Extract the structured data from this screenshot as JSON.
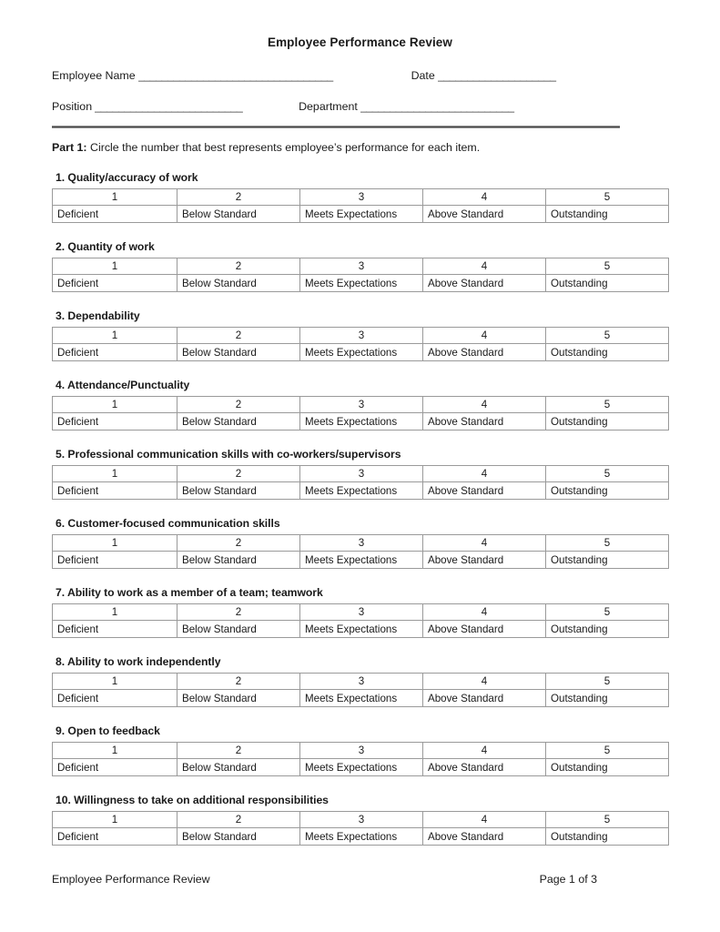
{
  "document": {
    "title": "Employee Performance Review"
  },
  "identification": {
    "employee_name_label": "Employee Name",
    "employee_name_value": "",
    "employee_name_rule": "_________________________________",
    "date_label": "Date",
    "date_value": "",
    "date_rule": "____________________",
    "position_label": "Position",
    "position_value": "",
    "position_rule": "_________________________",
    "department_label": "Department",
    "department_value": "",
    "department_rule": "__________________________"
  },
  "instructions": {
    "part_label": "Part 1:",
    "part_text": " Circle the number that best represents employee’s performance for each item."
  },
  "scale": {
    "scores": [
      "1",
      "2",
      "3",
      "4",
      "5"
    ],
    "labels": [
      "Deficient",
      "Below Standard",
      "Meets Expectations",
      "Above Standard",
      "Outstanding"
    ]
  },
  "items": [
    {
      "heading": "1. Quality/accuracy of work"
    },
    {
      "heading": "2. Quantity of work"
    },
    {
      "heading": "3. Dependability"
    },
    {
      "heading": "4. Attendance/Punctuality"
    },
    {
      "heading": "5. Professional communication skills with co-workers/supervisors"
    },
    {
      "heading": "6. Customer-focused communication skills"
    },
    {
      "heading": "7. Ability to work as a member of a team; teamwork"
    },
    {
      "heading": "8. Ability to work independently"
    },
    {
      "heading": "9. Open to feedback"
    },
    {
      "heading": "10. Willingness to take on additional responsibilities"
    }
  ],
  "footer": {
    "left_text": "Employee Performance Review",
    "right_text": "Page 1 of 3"
  }
}
